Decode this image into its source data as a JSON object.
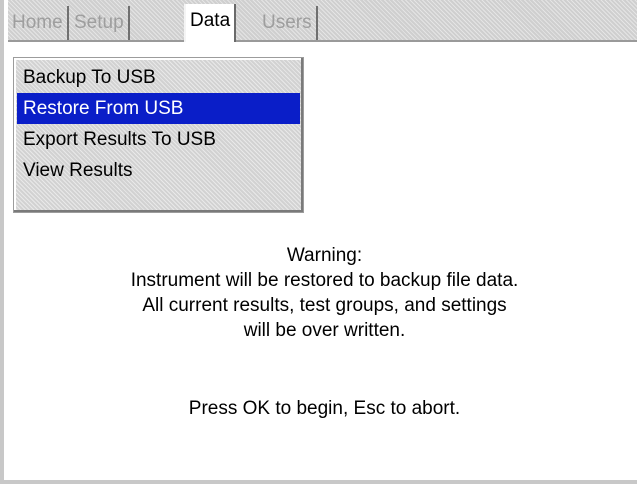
{
  "tabs": [
    {
      "label": "Home",
      "active": false
    },
    {
      "label": "Setup",
      "active": false
    },
    {
      "label": "Data",
      "active": true
    },
    {
      "label": "Users",
      "active": false
    }
  ],
  "menu": {
    "items": [
      {
        "label": "Backup To USB",
        "selected": false
      },
      {
        "label": "Restore From USB",
        "selected": true
      },
      {
        "label": "Export Results To USB",
        "selected": false
      },
      {
        "label": "View Results",
        "selected": false
      }
    ]
  },
  "message": {
    "lines": [
      "Warning:",
      "Instrument will be restored to backup file data.",
      "All current results, test groups, and settings",
      "will be over written."
    ],
    "prompt": "Press OK to begin, Esc to abort."
  },
  "colors": {
    "selection": "#0a1ec8",
    "inactive_tab_text": "#9e9e9e",
    "panel": "#d2d2d2"
  }
}
